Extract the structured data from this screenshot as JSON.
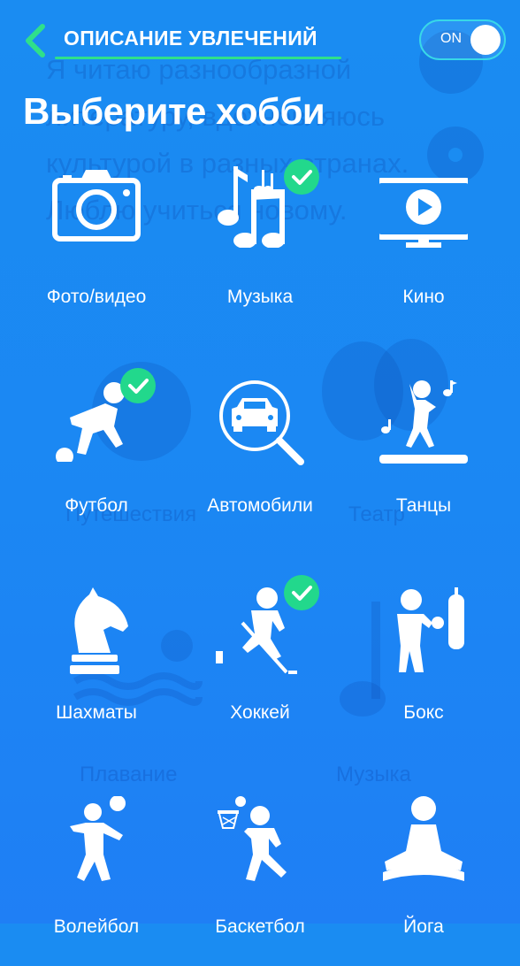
{
  "header": {
    "title": "ОПИСАНИЕ УВЛЕЧЕНИЙ",
    "toggle_label": "ON"
  },
  "page_title": "Выберите хобби",
  "background": {
    "ghost_text": "Я читаю разнообразной литературу, вдохновляюсь культурой в разных странах. Люблю учиться новому.",
    "ghost_labels": [
      "Путешествия",
      "Театр",
      "Плавание",
      "Музыка"
    ]
  },
  "colors": {
    "background": "#1a8cf2",
    "check": "#22d88c",
    "accent_line": "#2fe08a",
    "toggle_border": "#38d8e8"
  },
  "hobbies": [
    {
      "label": "Фото/видео",
      "icon": "camera-icon",
      "selected": false
    },
    {
      "label": "Музыка",
      "icon": "music-notes-icon",
      "selected": true
    },
    {
      "label": "Кино",
      "icon": "tv-play-icon",
      "selected": false
    },
    {
      "label": "Футбол",
      "icon": "football-player-icon",
      "selected": true
    },
    {
      "label": "Автомобили",
      "icon": "car-search-icon",
      "selected": false
    },
    {
      "label": "Танцы",
      "icon": "dancer-icon",
      "selected": false
    },
    {
      "label": "Шахматы",
      "icon": "chess-knight-icon",
      "selected": false
    },
    {
      "label": "Хоккей",
      "icon": "hockey-player-icon",
      "selected": true
    },
    {
      "label": "Бокс",
      "icon": "boxer-icon",
      "selected": false
    },
    {
      "label": "Волейбол",
      "icon": "volleyball-player-icon",
      "selected": false
    },
    {
      "label": "Баскетбол",
      "icon": "basketball-player-icon",
      "selected": false
    },
    {
      "label": "Йога",
      "icon": "yoga-icon",
      "selected": false
    }
  ]
}
